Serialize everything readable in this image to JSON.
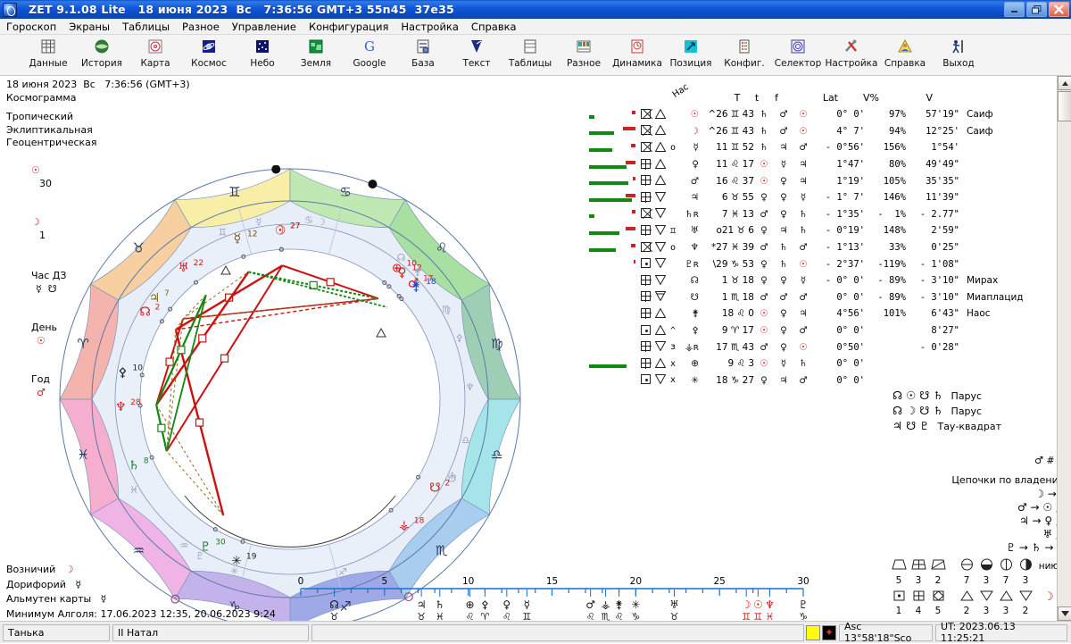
{
  "window": {
    "title": "ZET 9.1.08 Lite   18 июня 2023  Вс   7:36:56 GMT+3 55n45  37e35",
    "minimize_label": "—",
    "restore_label": "❐",
    "close_label": "✕"
  },
  "menu": {
    "items": [
      {
        "label": "Гороскоп"
      },
      {
        "label": "Экраны"
      },
      {
        "label": "Таблицы"
      },
      {
        "label": "Разное"
      },
      {
        "label": "Управление"
      },
      {
        "label": "Конфигурация"
      },
      {
        "label": "Настройка"
      },
      {
        "label": "Справка"
      }
    ]
  },
  "toolbar": {
    "buttons": [
      {
        "label": "Данные",
        "icon": "table-data-icon"
      },
      {
        "label": "История",
        "icon": "history-globe-icon"
      },
      {
        "label": "Карта",
        "icon": "chart-wheel-icon"
      },
      {
        "label": "Космос",
        "icon": "cosmos-planet-icon"
      },
      {
        "label": "Небо",
        "icon": "sky-stars-icon"
      },
      {
        "label": "Земля",
        "icon": "earth-map-icon"
      },
      {
        "label": "Google",
        "icon": "google-g-icon"
      },
      {
        "label": "База",
        "icon": "database-icon"
      },
      {
        "label": "Текст",
        "icon": "text-pen-icon"
      },
      {
        "label": "Таблицы",
        "icon": "tables-icon"
      },
      {
        "label": "Разное",
        "icon": "misc-icon"
      },
      {
        "label": "Динамика",
        "icon": "dynamics-clock-icon"
      },
      {
        "label": "Позиция",
        "icon": "position-arrow-icon"
      },
      {
        "label": "Конфиг.",
        "icon": "config-list-icon"
      },
      {
        "label": "Селектор",
        "icon": "selector-spiral-icon"
      },
      {
        "label": "Настройка",
        "icon": "settings-tools-icon"
      },
      {
        "label": "Справка",
        "icon": "help-person-icon"
      },
      {
        "label": "Выход",
        "icon": "exit-person-icon"
      }
    ]
  },
  "left_info": {
    "datetime": "18 июня 2023  Вс   7:36:56 (GMT+3)",
    "chart_type": "Космограмма",
    "zodiac": "Тропический",
    "coord_system": "Эклиптикальная",
    "center": "Геоцентрическая",
    "sun_label": "☉",
    "sun_value": "30",
    "moon_label": "☽",
    "moon_value": "1",
    "hour_label": "Час ДЗ",
    "hour_value": "☿  ☋",
    "day_label": "День",
    "day_value": "☉",
    "year_label": "Год",
    "year_value": "♂"
  },
  "bottom_left": {
    "rows": [
      {
        "label": "Возничий",
        "value": "☽"
      },
      {
        "label": "Дорифорий",
        "value": "☿"
      },
      {
        "label": "Альмутен карты",
        "value": "☿"
      }
    ],
    "algol": "Минимум Алголя: 17.06.2023 12:35,  20.06.2023  9:24"
  },
  "planet_table": {
    "header": {
      "has": "Нас",
      "T": "T",
      "t": "t",
      "f": "f",
      "lat": "Lat",
      "vp": "V%",
      "v": "V"
    },
    "rows": [
      {
        "bar_g": 6,
        "bar_r": 7,
        "i1": "diag",
        "i2": "tri-up",
        "s": "",
        "planet": "☉",
        "pos": "^26 ♊ 43",
        "T": "♄",
        "t": "♂",
        "f": "☉",
        "lat": "0° 0'",
        "vp": "97%",
        "v": "57'19\"",
        "star": "Саиф"
      },
      {
        "bar_g": 28,
        "bar_r": 22,
        "i1": "diag",
        "i2": "tri-up",
        "s": "",
        "planet": "☽",
        "pos": "^26 ♊ 43",
        "T": "♄",
        "t": "♂",
        "f": "☉",
        "lat": "4° 7'",
        "vp": "94%",
        "v": "12°25'",
        "star": "Саиф"
      },
      {
        "bar_g": 26,
        "bar_r": 8,
        "i1": "diag",
        "i2": "tri-up",
        "s": "o",
        "planet": "☿",
        "pos": "11 ♊ 52",
        "T": "♄",
        "t": "♃",
        "f": "♂",
        "lat": "- 0°56'",
        "vp": "156%",
        "v": "1°54'",
        "star": ""
      },
      {
        "bar_g": 42,
        "bar_r": 18,
        "i1": "grid",
        "i2": "tri-up",
        "s": "",
        "planet": "♀",
        "pos": "11 ♌ 17",
        "T": "☉",
        "t": "☿",
        "f": "♃",
        "lat": "1°47'",
        "vp": "80%",
        "v": "49'49\"",
        "star": ""
      },
      {
        "bar_g": 44,
        "bar_r": 5,
        "i1": "grid",
        "i2": "tri-up",
        "s": "",
        "planet": "♂",
        "pos": "16 ♌ 37",
        "T": "☉",
        "t": "♀",
        "f": "♃",
        "lat": "1°19'",
        "vp": "105%",
        "v": "35'35\"",
        "star": ""
      },
      {
        "bar_g": 48,
        "bar_r": 17,
        "i1": "grid",
        "i2": "tri-dn",
        "s": "",
        "planet": "♃",
        "pos": "6 ♉ 55",
        "T": "♀",
        "t": "♀",
        "f": "☿",
        "lat": "- 1° 7'",
        "vp": "146%",
        "v": "11'39\"",
        "star": ""
      },
      {
        "bar_g": 6,
        "bar_r": 7,
        "i1": "diag",
        "i2": "tri-dn",
        "s": "",
        "planet": "♄ʀ",
        "pos": "7 ♓ 13",
        "T": "♂",
        "t": "♀",
        "f": "♄",
        "lat": "- 1°35'",
        "vp": "-  1%",
        "v": "- 2.77\"",
        "star": ""
      },
      {
        "bar_g": 34,
        "bar_r": 18,
        "i1": "grid",
        "i2": "tri-dn",
        "s": "♊",
        "planet": "♅",
        "pos": "o21 ♉ 6",
        "T": "♀",
        "t": "♃",
        "f": "♄",
        "lat": "- 0°19'",
        "vp": "148%",
        "v": "2'59\"",
        "star": ""
      },
      {
        "bar_g": 30,
        "bar_r": 8,
        "i1": "diag",
        "i2": "tri-dn",
        "s": "o",
        "planet": "♆",
        "pos": "*27 ♓ 39",
        "T": "♂",
        "t": "♄",
        "f": "♂",
        "lat": "- 1°13'",
        "vp": "33%",
        "v": "0'25\"",
        "star": ""
      },
      {
        "bar_g": 0,
        "bar_r": 4,
        "i1": "dot",
        "i2": "tri-dn",
        "s": "",
        "planet": "♇ʀ",
        "pos": "\\29 ♑ 53",
        "T": "♀",
        "t": "♄",
        "f": "☉",
        "lat": "- 2°37'",
        "vp": "-119%",
        "v": "- 1'08\"",
        "star": ""
      },
      {
        "bar_g": 0,
        "bar_r": 0,
        "i1": "grid",
        "i2": "tri-dn",
        "s": "",
        "planet": "☊",
        "pos": "1 ♉ 18",
        "T": "♀",
        "t": "♀",
        "f": "☿",
        "lat": "- 0° 0'",
        "vp": "- 89%",
        "v": "- 3'10\"",
        "star": "Мирах"
      },
      {
        "bar_g": 0,
        "bar_r": 0,
        "i1": "grid",
        "i2": "tri-dn2",
        "s": "",
        "planet": "☋",
        "pos": "1 ♏ 18",
        "T": "♂",
        "t": "♂",
        "f": "♂",
        "lat": "0° 0'",
        "vp": "- 89%",
        "v": "- 3'10\"",
        "star": "Миаплацид"
      },
      {
        "bar_g": 0,
        "bar_r": 0,
        "i1": "grid",
        "i2": "tri-up",
        "s": "",
        "planet": "⚵",
        "pos": "18 ♌ 0",
        "T": "☉",
        "t": "♀",
        "f": "♃",
        "lat": "4°56'",
        "vp": "101%",
        "v": "6'43\"",
        "star": "Наос"
      },
      {
        "bar_g": 0,
        "bar_r": 0,
        "i1": "dot",
        "i2": "tri-up",
        "s": "^",
        "planet": "⚴",
        "pos": "9 ♈ 17",
        "T": "☉",
        "t": "♀",
        "f": "♂",
        "lat": "0° 0'",
        "vp": "",
        "v": "8'27\"",
        "star": ""
      },
      {
        "bar_g": 0,
        "bar_r": 0,
        "i1": "grid",
        "i2": "tri-dn",
        "s": "ɜ",
        "planet": "⚶ʀ",
        "pos": "17 ♏ 43",
        "T": "♂",
        "t": "♀",
        "f": "☉",
        "lat": "0°50'",
        "vp": "",
        "v": "- 0'28\"",
        "star": ""
      },
      {
        "bar_g": 42,
        "bar_r": 0,
        "i1": "grid",
        "i2": "tri-up",
        "s": "x",
        "planet": "⊕",
        "pos": "9 ♌ 3",
        "T": "☉",
        "t": "☿",
        "f": "♄",
        "lat": "0° 0'",
        "vp": "",
        "v": "",
        "star": ""
      },
      {
        "bar_g": 0,
        "bar_r": 0,
        "i1": "dot",
        "i2": "tri-dn",
        "s": "x",
        "planet": "✳",
        "pos": "18 ♑ 27",
        "T": "♀",
        "t": "♃",
        "f": "♂",
        "lat": "0° 0'",
        "vp": "",
        "v": "",
        "star": ""
      }
    ]
  },
  "config_panel": {
    "figures": [
      {
        "glyphs": "☊ ☉ ☋ ♄",
        "name": "Парус"
      },
      {
        "glyphs": "☊ ☽ ☋ ♄",
        "name": "Парус"
      },
      {
        "glyphs": "♃ ☋ ♇",
        "name": "Тау-квадрат"
      }
    ],
    "note": "♂ # ♇",
    "chains_title": "Цепочки по владению",
    "chains": [
      "☽ → ☿",
      "♂ → ☉ ⤴",
      "♃ → ♀ ⤴",
      "♅ ⤴",
      "♇ → ♄ → ♆"
    ]
  },
  "dignities": {
    "row1_icons": [
      "trapezoid",
      "grid-box",
      "diag-box"
    ],
    "row1_values": [
      "5",
      "3",
      "2"
    ],
    "row2_icons": [
      "dot-box",
      "grid-box",
      "diag-box"
    ],
    "row2_values": [
      "1",
      "4",
      "5"
    ],
    "row3_icons": [
      "circle-half-h",
      "circle-half-b",
      "circle-half-l",
      "circle-half-r"
    ],
    "row3_values": [
      "7",
      "3",
      "7",
      "3"
    ],
    "row4_icons": [
      "tri-up",
      "tri-dn",
      "tri-up",
      "tri-dn"
    ],
    "row4_values": [
      "2",
      "3",
      "3",
      "2"
    ],
    "side_label": "нию",
    "side_glyph": "☽"
  },
  "chart_data": {
    "type": "wheel",
    "title": "Космограмма",
    "zodiac_signs": [
      {
        "name": "Овен",
        "glyph": "♈",
        "color": "#f4b3ad"
      },
      {
        "name": "Телец",
        "glyph": "♉",
        "color": "#f7cfa0"
      },
      {
        "name": "Близнецы",
        "glyph": "♊",
        "color": "#f8eea6"
      },
      {
        "name": "Рак",
        "glyph": "♋",
        "color": "#bfe8b2"
      },
      {
        "name": "Лев",
        "glyph": "♌",
        "color": "#a7e0a0"
      },
      {
        "name": "Дева",
        "glyph": "♍",
        "color": "#9ecfb4"
      },
      {
        "name": "Весы",
        "glyph": "♎",
        "color": "#a5e4e8"
      },
      {
        "name": "Скорпион",
        "glyph": "♏",
        "color": "#a9cdee"
      },
      {
        "name": "Стрелец",
        "glyph": "♐",
        "color": "#9fa9e8"
      },
      {
        "name": "Козерог",
        "glyph": "♑",
        "color": "#c3b3ea"
      },
      {
        "name": "Водолей",
        "glyph": "♒",
        "color": "#efb3e6"
      },
      {
        "name": "Рыбы",
        "glyph": "♓",
        "color": "#f6aece"
      }
    ],
    "planets": [
      {
        "glyph": "☉",
        "deg": 27,
        "label": "27",
        "lon": 86.7,
        "color": "#d11a1a"
      },
      {
        "glyph": "☽",
        "deg": 27,
        "label": "27",
        "lon": 86.7,
        "color": "#d11a1a"
      },
      {
        "glyph": "☿",
        "deg": 12,
        "label": "12",
        "lon": 71.9,
        "color": "#7a4a1a"
      },
      {
        "glyph": "♀",
        "deg": 12,
        "label": "12",
        "lon": 131.3,
        "color": "#d11a1a"
      },
      {
        "glyph": "♂",
        "deg": 17,
        "label": "17",
        "lon": 136.6,
        "color": "#d11a1a"
      },
      {
        "glyph": "♃",
        "deg": 7,
        "label": "7",
        "lon": 36.9,
        "color": "#7a6a1a"
      },
      {
        "glyph": "♄",
        "deg": 8,
        "label": "8",
        "lon": 337.2,
        "color": "#1a7a2a"
      },
      {
        "glyph": "♅",
        "deg": 22,
        "label": "22",
        "lon": 51.1,
        "color": "#d11a1a"
      },
      {
        "glyph": "♆",
        "deg": 28,
        "label": "28",
        "lon": 357.6,
        "color": "#d11a1a"
      },
      {
        "glyph": "♇",
        "deg": 30,
        "label": "30",
        "lon": 299.9,
        "color": "#1a7a2a"
      },
      {
        "glyph": "☊",
        "deg": 2,
        "label": "2",
        "lon": 31.3,
        "color": "#d11a1a"
      },
      {
        "glyph": "☋",
        "deg": 2,
        "label": "2",
        "lon": 211.3,
        "color": "#d11a1a"
      },
      {
        "glyph": "⚵",
        "deg": 18,
        "label": "18",
        "lon": 138.0,
        "color": "#1a44c0"
      },
      {
        "glyph": "⚴",
        "deg": 10,
        "label": "10",
        "lon": 9.3,
        "color": "#222"
      },
      {
        "glyph": "⚶",
        "deg": 18,
        "label": "18",
        "lon": 227.7,
        "color": "#d11a1a"
      },
      {
        "glyph": "⊕",
        "deg": 10,
        "label": "10",
        "lon": 129.0,
        "color": "#d11a1a"
      },
      {
        "glyph": "✳",
        "deg": 19,
        "label": "19",
        "lon": 288.4,
        "color": "#222"
      }
    ],
    "aspect_colors": {
      "square": "#cc1111",
      "trine": "#118811",
      "minor": "#8a6a20"
    }
  },
  "taskbar": {
    "items": [
      {
        "label": "Танька"
      },
      {
        "label": "II Натал"
      }
    ]
  },
  "statusbar": {
    "asc": "Asc  13°58'18\"Sco",
    "ut": "UT: 2023.06.13 11:25:21"
  }
}
